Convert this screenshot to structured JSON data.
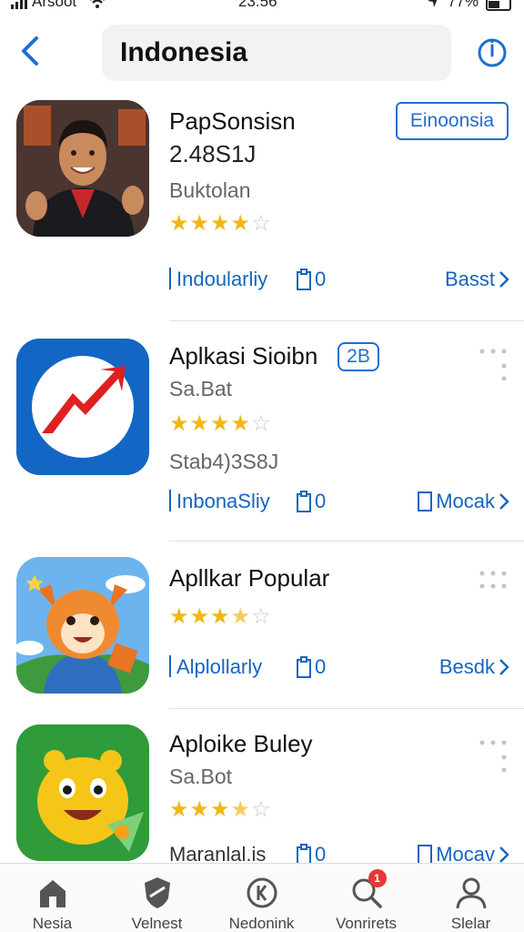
{
  "status_bar": {
    "carrier": "Arsoot",
    "time": "23:56",
    "battery": "77%"
  },
  "header": {
    "search_text": "Indonesia",
    "icons": {
      "back": "chevron-left-icon",
      "info": "info-circle-icon"
    }
  },
  "apps": [
    {
      "title": "PapSonsisn",
      "line2": "2.48S1J",
      "line3": "Buktolan",
      "rating": 4,
      "tag": "Einoonsia",
      "meta_label": "Indoularliy",
      "meta_count": "0",
      "action": "Basst"
    },
    {
      "title": "Aplkasi Sioibn",
      "tag": "2B",
      "line2": "Sa.Bat",
      "rating": 4,
      "line3": "Stab4)3S8J",
      "meta_label": "InbonaSliy",
      "meta_count": "0",
      "action": "Mocak"
    },
    {
      "title": "Apllkar Popular",
      "rating": 3.5,
      "meta_label": "Alplollarly",
      "meta_count": "0",
      "action": "Besdk"
    },
    {
      "title": "Aploike Buley",
      "line2": "Sa.Bot",
      "rating": 3.5,
      "meta_label": "Maranlal.is",
      "meta_count": "0",
      "action": "Mocav"
    }
  ],
  "tabbar": {
    "tabs": [
      {
        "label": "Nesia",
        "icon": "store-icon"
      },
      {
        "label": "Velnest",
        "icon": "shield-icon"
      },
      {
        "label": "Nedonink",
        "icon": "k-circle-icon"
      },
      {
        "label": "Vonrirets",
        "icon": "search-icon",
        "badge": "1"
      },
      {
        "label": "Slelar",
        "icon": "person-icon"
      }
    ]
  },
  "colors": {
    "accent": "#1565c0",
    "star": "#f3b614",
    "badge": "#e53935"
  }
}
